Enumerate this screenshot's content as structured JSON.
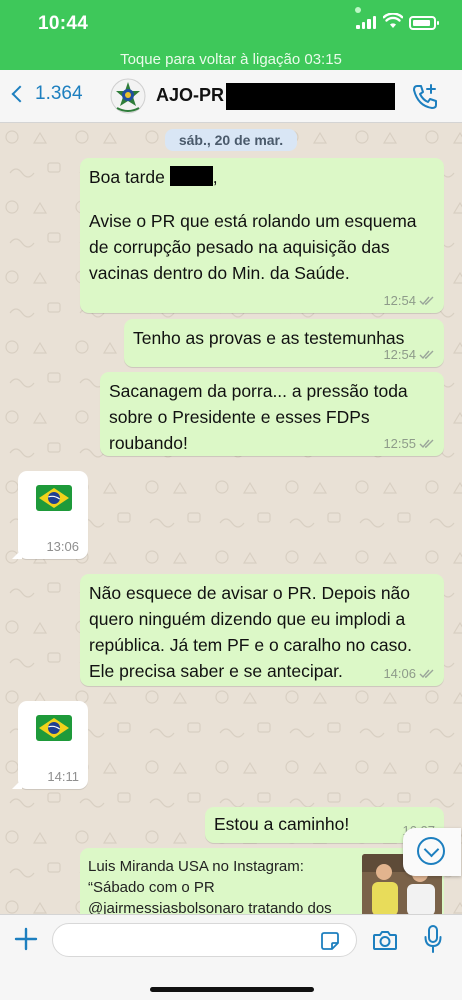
{
  "status_bar": {
    "time": "10:44"
  },
  "call_banner": {
    "text": "Toque para voltar à ligação 03:15"
  },
  "header": {
    "back_label": "1.364",
    "contact_name": "AJO-PR"
  },
  "chat": {
    "date_chip": "sáb., 20 de mar.",
    "messages": [
      {
        "dir": "out",
        "line1": "Boa tarde",
        "line1_suffix": ",",
        "body": "Avise o PR que está rolando um esquema de corrupção pesado na aquisição das vacinas dentro do Min. da Saúde.",
        "time": "12:54"
      },
      {
        "dir": "out",
        "body": "Tenho as provas e as testemunhas",
        "time": "12:54"
      },
      {
        "dir": "out",
        "body": "Sacanagem da porra... a pressão toda sobre o Presidente e esses FDPs roubando!",
        "time": "12:55"
      },
      {
        "dir": "in",
        "emoji": "brazil-flag",
        "time": "13:06"
      },
      {
        "dir": "out",
        "body": "Não esquece de avisar o PR. Depois não quero ninguém dizendo que eu implodi a república. Já tem PF e o caralho no caso. Ele precisa saber e se antecipar.",
        "time": "14:06"
      },
      {
        "dir": "in",
        "emoji": "brazil-flag",
        "time": "14:11"
      },
      {
        "dir": "out",
        "body": "Estou a caminho!",
        "time": "16:07"
      },
      {
        "dir": "out",
        "link_preview": "Luis Miranda USA no Instagram: “Sábado com o PR @jairmessiasbolsonaro tratando dos"
      }
    ]
  },
  "colors": {
    "status_green": "#3ec85a",
    "outgoing_bubble": "#dcf8c7",
    "incoming_bubble": "#ffffff",
    "accent_blue": "#1d7fbf",
    "chat_background": "#e9e1d6"
  },
  "input": {
    "value": "",
    "placeholder": ""
  }
}
